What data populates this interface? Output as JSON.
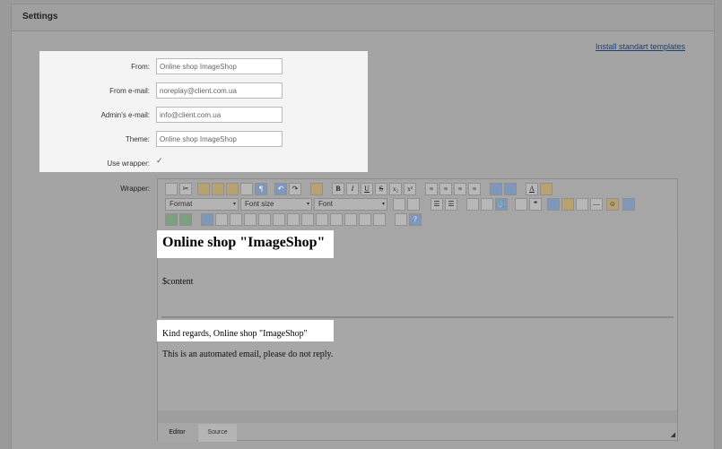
{
  "panel": {
    "title": "Settings"
  },
  "install_link": "Install standart templates",
  "form": {
    "from_label": "From:",
    "from_value": "Online shop ImageShop",
    "from_email_label": "From e-mail:",
    "from_email_value": "noreplay@client.com.ua",
    "admin_email_label": "Admin's e-mail:",
    "admin_email_value": "info@client.com.ua",
    "theme_label": "Theme:",
    "theme_value": "Online shop ImageShop",
    "use_wrapper_label": "Use wrapper:",
    "use_wrapper_checked": "✓"
  },
  "wrapper_label": "Wrapper:",
  "toolbar": {
    "format_label": "Format",
    "font_size_label": "Font size",
    "font_label": "Font",
    "bold": "B",
    "italic": "I",
    "underline": "U",
    "strike": "S",
    "subscript": "x₂",
    "superscript": "x²",
    "dropdown_arrow": "▾"
  },
  "content": {
    "heading": "Online shop \"ImageShop\"",
    "variable": "$content",
    "regards": "Kind regards, Online shop \"ImageShop\"",
    "automated": "This is an automated email, please do not reply."
  },
  "tabs": {
    "editor": "Editor",
    "source": "Source"
  },
  "resize_glyph": "◢"
}
